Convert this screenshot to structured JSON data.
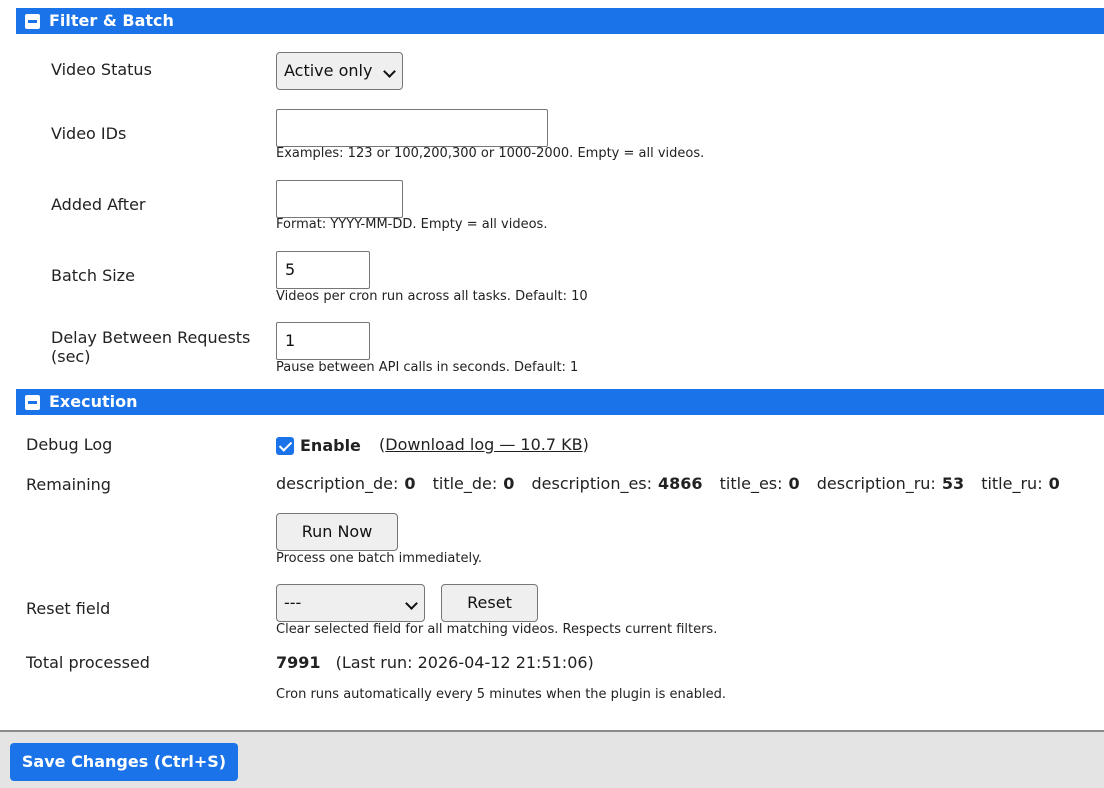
{
  "filter_section": {
    "title": "Filter & Batch",
    "video_status": {
      "label": "Video Status",
      "selected": "Active only"
    },
    "video_ids": {
      "label": "Video IDs",
      "value": "",
      "hint": "Examples: 123 or 100,200,300 or 1000-2000. Empty = all videos."
    },
    "added_after": {
      "label": "Added After",
      "value": "",
      "hint": "Format: YYYY-MM-DD. Empty = all videos."
    },
    "batch_size": {
      "label": "Batch Size",
      "value": "5",
      "hint": "Videos per cron run across all tasks. Default: 10"
    },
    "delay": {
      "label_line1": "Delay Between Requests",
      "label_line2": "(sec)",
      "value": "1",
      "hint": "Pause between API calls in seconds. Default: 1"
    }
  },
  "execution_section": {
    "title": "Execution",
    "debug_log": {
      "label": "Debug Log",
      "checkbox_label": "Enable",
      "checked": true,
      "paren_open": "(",
      "download_link": "Download log — 10.7 KB",
      "paren_close": ")"
    },
    "remaining": {
      "label": "Remaining",
      "items": [
        {
          "key": "description_de:",
          "value": "0"
        },
        {
          "key": "title_de:",
          "value": "0"
        },
        {
          "key": "description_es:",
          "value": "4866"
        },
        {
          "key": "title_es:",
          "value": "0"
        },
        {
          "key": "description_ru:",
          "value": "53"
        },
        {
          "key": "title_ru:",
          "value": "0"
        }
      ]
    },
    "run_now": {
      "button": "Run Now",
      "hint": "Process one batch immediately."
    },
    "reset_field": {
      "label": "Reset field",
      "selected": "---",
      "button": "Reset",
      "hint": "Clear selected field for all matching videos. Respects current filters."
    },
    "total_processed": {
      "label": "Total processed",
      "value": "7991",
      "last_run": "(Last run: 2026-04-12 21:51:06)"
    },
    "cron_note": "Cron runs automatically every 5 minutes when the plugin is enabled."
  },
  "footer": {
    "save_button": "Save Changes (Ctrl+S)"
  },
  "colors": {
    "accent": "#1a73e8"
  }
}
